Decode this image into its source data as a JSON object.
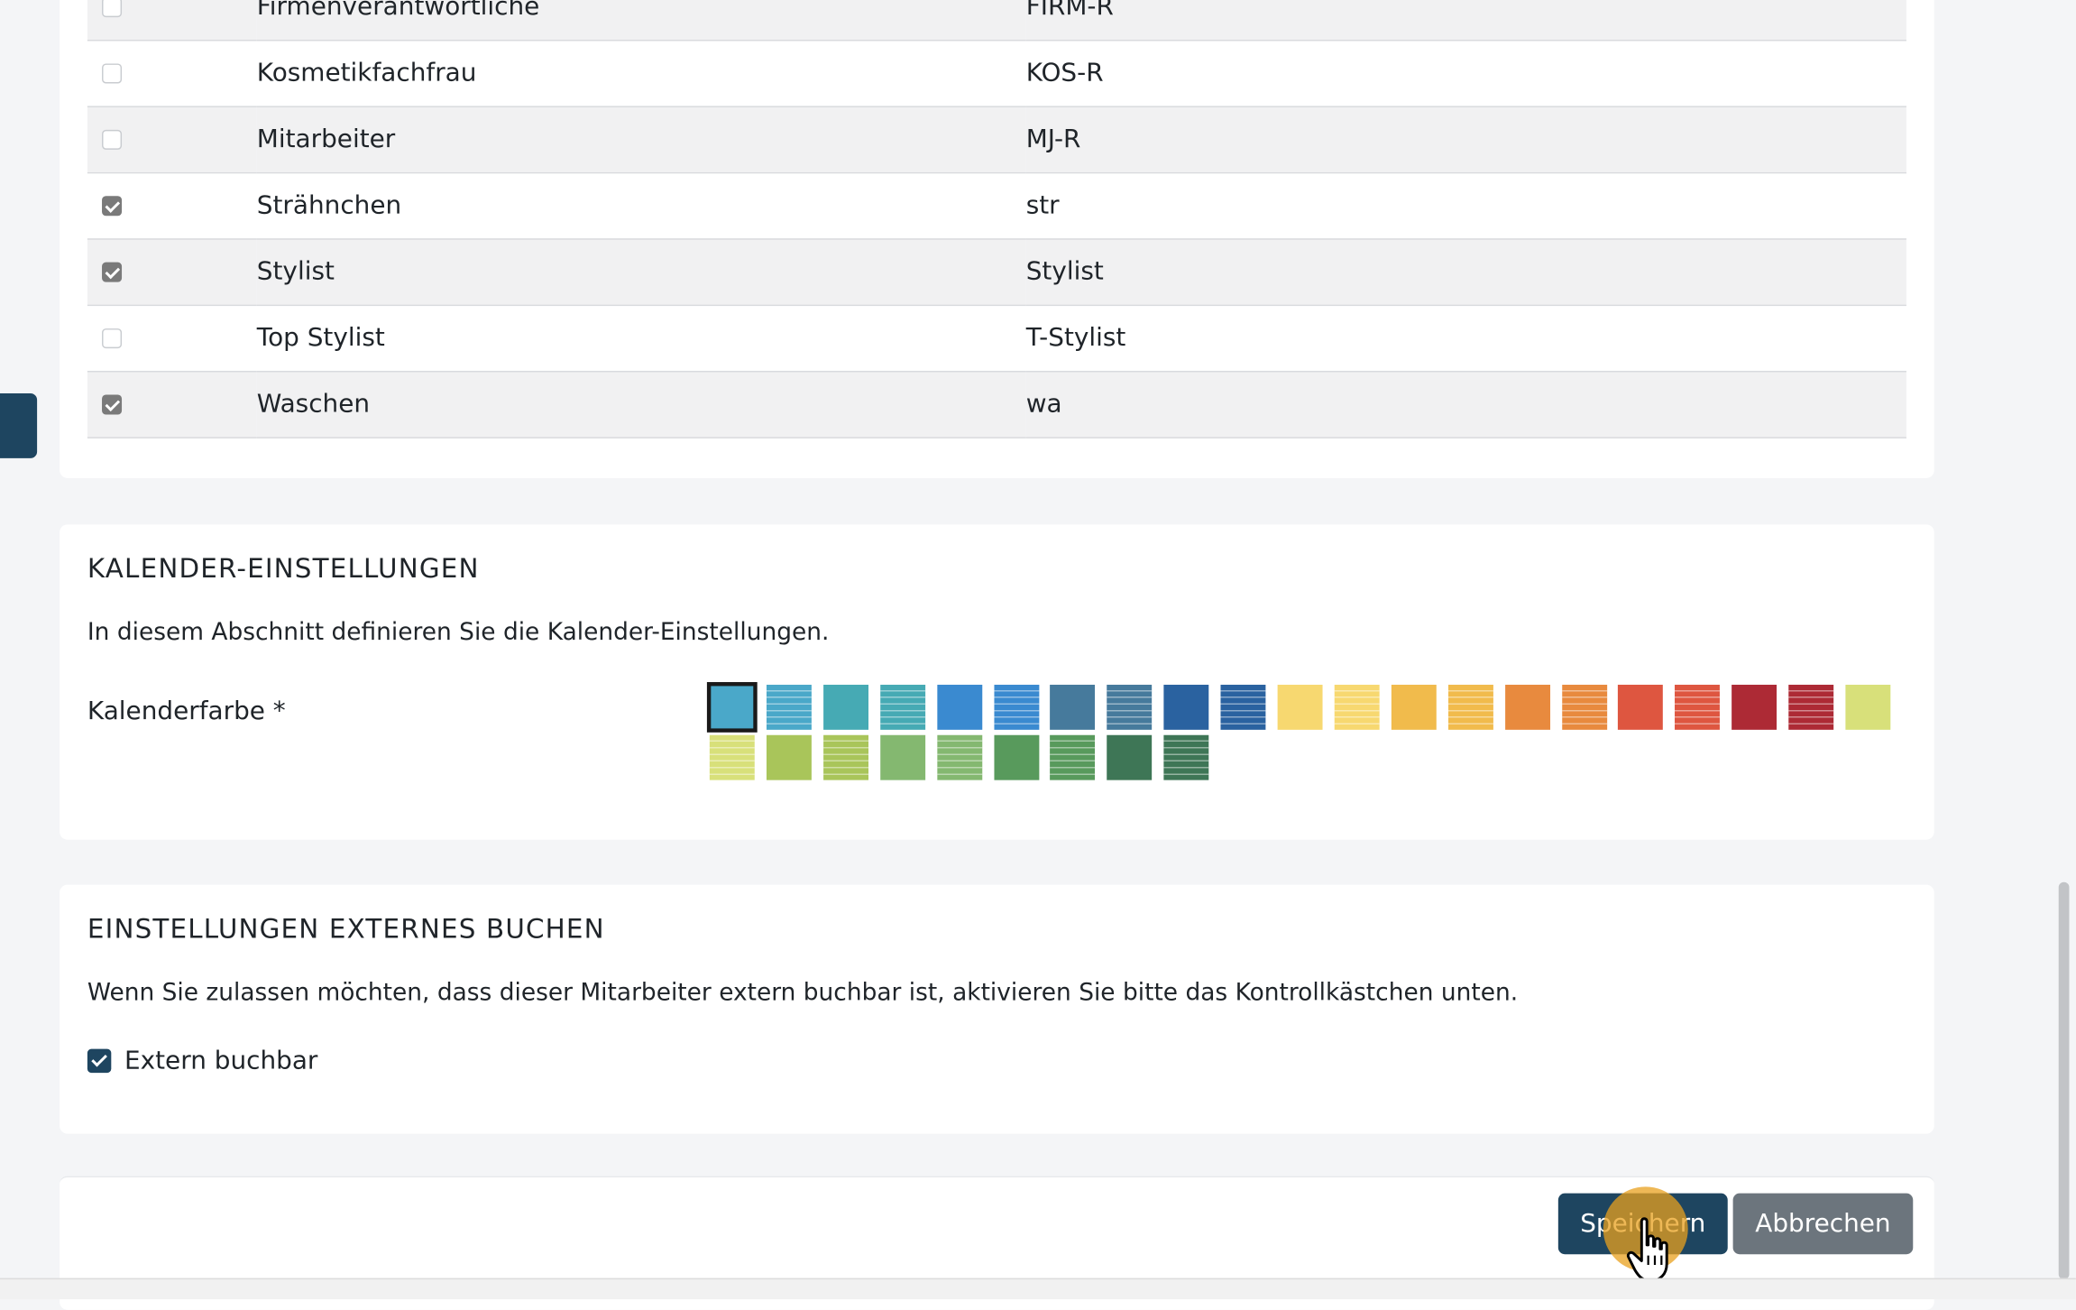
{
  "roles": {
    "rows": [
      {
        "name": "Firmenverantwortliche",
        "code": "FIRM-R",
        "checked": false
      },
      {
        "name": "Kosmetikfachfrau",
        "code": "KOS-R",
        "checked": false
      },
      {
        "name": "Mitarbeiter",
        "code": "MJ-R",
        "checked": false
      },
      {
        "name": "Strähnchen",
        "code": "str",
        "checked": true
      },
      {
        "name": "Stylist",
        "code": "Stylist",
        "checked": true
      },
      {
        "name": "Top Stylist",
        "code": "T-Stylist",
        "checked": false
      },
      {
        "name": "Waschen",
        "code": "wa",
        "checked": true
      }
    ]
  },
  "calendar": {
    "title": "KALENDER-EINSTELLUNGEN",
    "description": "In diesem Abschnitt definieren Sie die Kalender-Einstellungen.",
    "color_label": "Kalenderfarbe *",
    "swatches": [
      {
        "color": "#4aa8c9",
        "striped": false,
        "selected": true
      },
      {
        "color": "#4aa8c9",
        "striped": true,
        "selected": false
      },
      {
        "color": "#46aab4",
        "striped": false,
        "selected": false
      },
      {
        "color": "#46aab4",
        "striped": true,
        "selected": false
      },
      {
        "color": "#3a8ad0",
        "striped": false,
        "selected": false
      },
      {
        "color": "#3a8ad0",
        "striped": true,
        "selected": false
      },
      {
        "color": "#467a9c",
        "striped": false,
        "selected": false
      },
      {
        "color": "#467a9c",
        "striped": true,
        "selected": false
      },
      {
        "color": "#2a62a0",
        "striped": false,
        "selected": false
      },
      {
        "color": "#2a62a0",
        "striped": true,
        "selected": false
      },
      {
        "color": "#f7d870",
        "striped": false,
        "selected": false
      },
      {
        "color": "#f7d870",
        "striped": true,
        "selected": false
      },
      {
        "color": "#f1bb4c",
        "striped": false,
        "selected": false
      },
      {
        "color": "#f1bb4c",
        "striped": true,
        "selected": false
      },
      {
        "color": "#e88a3e",
        "striped": false,
        "selected": false
      },
      {
        "color": "#e88a3e",
        "striped": true,
        "selected": false
      },
      {
        "color": "#de5640",
        "striped": false,
        "selected": false
      },
      {
        "color": "#de5640",
        "striped": true,
        "selected": false
      },
      {
        "color": "#ad2a35",
        "striped": false,
        "selected": false
      },
      {
        "color": "#ad2a35",
        "striped": true,
        "selected": false
      },
      {
        "color": "#d8e07a",
        "striped": false,
        "selected": false
      },
      {
        "color": "#d8e07a",
        "striped": true,
        "selected": false
      },
      {
        "color": "#a9c55a",
        "striped": false,
        "selected": false
      },
      {
        "color": "#a9c55a",
        "striped": true,
        "selected": false
      },
      {
        "color": "#84b870",
        "striped": false,
        "selected": false
      },
      {
        "color": "#84b870",
        "striped": true,
        "selected": false
      },
      {
        "color": "#589a5c",
        "striped": false,
        "selected": false
      },
      {
        "color": "#589a5c",
        "striped": true,
        "selected": false
      },
      {
        "color": "#3e7656",
        "striped": false,
        "selected": false
      },
      {
        "color": "#3e7656",
        "striped": true,
        "selected": false
      }
    ]
  },
  "external": {
    "title": "EINSTELLUNGEN EXTERNES BUCHEN",
    "description": "Wenn Sie zulassen möchten, dass dieser Mitarbeiter extern buchbar ist, aktivieren Sie bitte das Kontrollkästchen unten.",
    "checkbox_label": "Extern buchbar",
    "checked": true
  },
  "footer": {
    "save_label": "Speichern",
    "cancel_label": "Abbrechen"
  },
  "colors": {
    "primary": "#1e4560",
    "secondary": "#6c757d",
    "click_highlight": "#e8a01e"
  }
}
